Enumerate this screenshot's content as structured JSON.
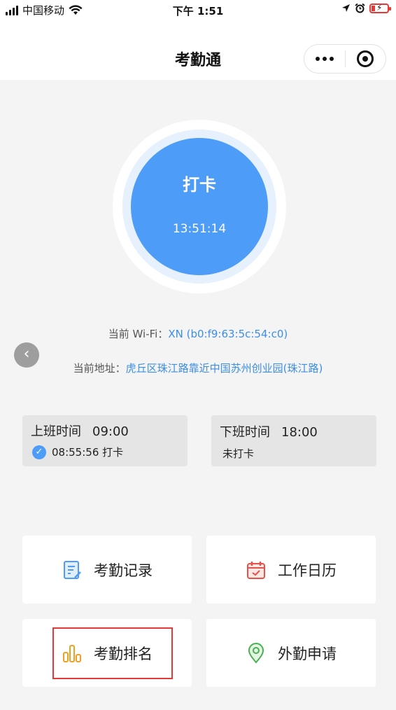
{
  "status_bar": {
    "carrier": "中国移动",
    "time": "下午 1:51"
  },
  "nav": {
    "title": "考勤通"
  },
  "punch": {
    "label": "打卡",
    "time": "13:51:14"
  },
  "wifi": {
    "label": "当前 Wi-Fi：",
    "value": "XN (b0:f9:63:5c:54:c0)"
  },
  "address": {
    "label": "当前地址：",
    "value": "虎丘区珠江路靠近中国苏州创业园(珠江路)"
  },
  "shifts": {
    "on": {
      "title": "上班时间",
      "time": "09:00",
      "status": "08:55:56 打卡"
    },
    "off": {
      "title": "下班时间",
      "time": "18:00",
      "status": "未打卡"
    }
  },
  "tiles": [
    {
      "label": "考勤记录",
      "icon": "record-icon",
      "color": "#4c9cf8"
    },
    {
      "label": "工作日历",
      "icon": "calendar-icon",
      "color": "#e5534b"
    },
    {
      "label": "考勤排名",
      "icon": "ranking-icon",
      "color": "#f0a020"
    },
    {
      "label": "外勤申请",
      "icon": "location-icon",
      "color": "#4caf50"
    }
  ],
  "colors": {
    "accent": "#4c9cf8",
    "highlight": "#e53935"
  }
}
